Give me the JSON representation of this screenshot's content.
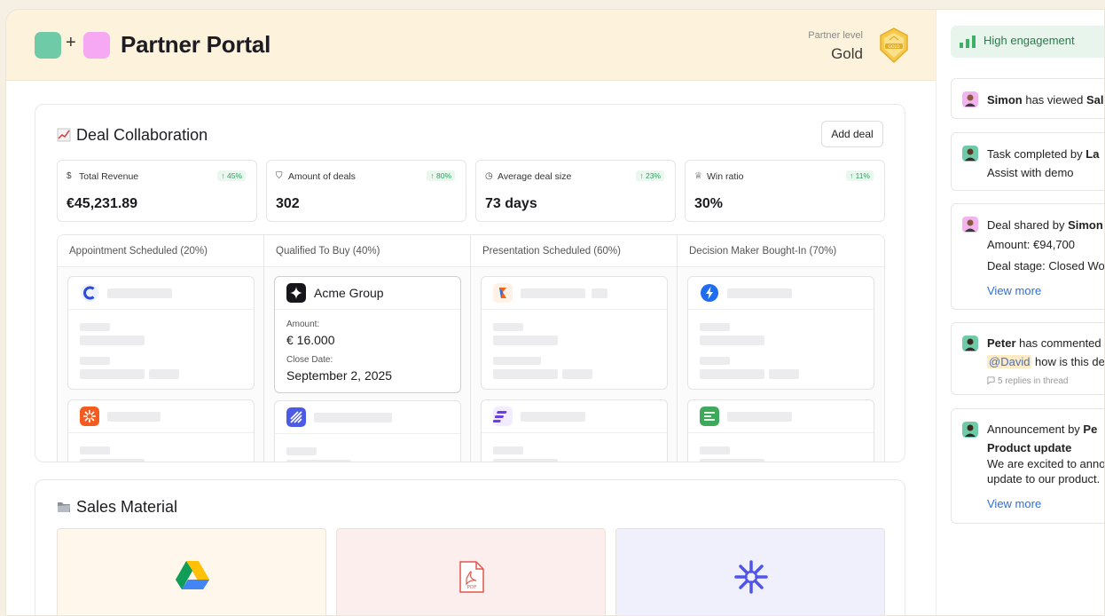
{
  "header": {
    "title": "Partner Portal",
    "logo_plus": "+",
    "partner_level_label": "Partner level",
    "partner_level_value": "Gold",
    "badge_text": "GOLD"
  },
  "deal_collab": {
    "title": "Deal Collaboration",
    "add_button": "Add deal",
    "stats": [
      {
        "icon": "$",
        "label": "Total Revenue",
        "delta": "↑ 45%",
        "value": "€45,231.89"
      },
      {
        "icon": "⛉",
        "label": "Amount of deals",
        "delta": "↑ 80%",
        "value": "302"
      },
      {
        "icon": "◷",
        "label": "Average deal size",
        "delta": "↑ 23%",
        "value": "73 days"
      },
      {
        "icon": "♕",
        "label": "Win ratio",
        "delta": "↑ 11%",
        "value": "30%"
      }
    ],
    "stages": [
      {
        "title": "Appointment Scheduled (20%)"
      },
      {
        "title": "Qualified To Buy (40%)"
      },
      {
        "title": "Presentation Scheduled (60%)"
      },
      {
        "title": "Decision Maker Bought-In (70%)"
      }
    ],
    "featured_deal": {
      "name": "Acme Group",
      "amount_label": "Amount:",
      "amount": "€ 16.000",
      "close_label": "Close Date:",
      "close_date": "September 2, 2025"
    }
  },
  "sales_material": {
    "title": "Sales Material",
    "pdf_label": "PDF"
  },
  "sidepanel": {
    "engagement": "High engagement",
    "feed": [
      {
        "name": "Simon",
        "text": " has viewed ",
        "tail": "Sal"
      },
      {
        "name": "",
        "text": "Task completed by ",
        "tail": "La",
        "line2": "Assist with demo"
      },
      {
        "name": "",
        "text": "Deal shared by ",
        "tail": "Simon",
        "line2": "Amount: €94,700",
        "line3": "Deal stage: Closed Wo",
        "link": "View more"
      },
      {
        "name": "Peter",
        "text": " has commented",
        "mention": "@David",
        "line2_tail": " how is this dea",
        "replies": "5 replies in thread"
      },
      {
        "name": "",
        "text": "Announcement by ",
        "tail": "Pe",
        "heading": "Product update",
        "line2": "We are excited to anno",
        "line3": "update to our product.",
        "link": "View more"
      }
    ]
  },
  "colors": {
    "header_bg": "#fdf3dc",
    "brand_green": "#6fcba7",
    "brand_pink": "#f7a8f3",
    "link_blue": "#2f6fd6",
    "delta_green": "#2f9e5d",
    "engagement_bg": "#e7f5ec"
  }
}
